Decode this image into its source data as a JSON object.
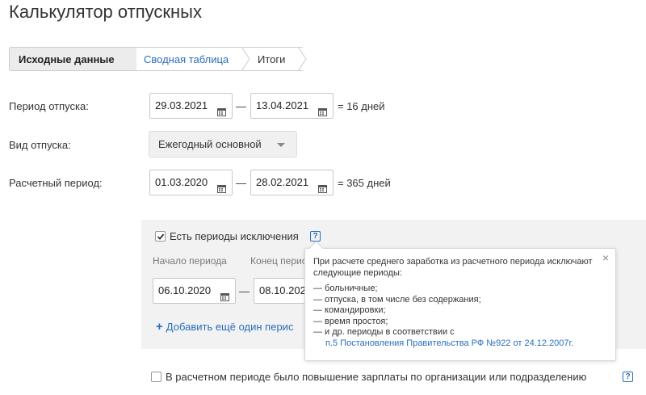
{
  "page": {
    "title": "Калькулятор отпускных"
  },
  "steps": [
    {
      "label": "Исходные данные"
    },
    {
      "label": "Сводная таблица"
    },
    {
      "label": "Итоги"
    }
  ],
  "vacation_period": {
    "label": "Период отпуска:",
    "from": "29.03.2021",
    "to": "13.04.2021",
    "separator": "—",
    "result": "= 16 дней"
  },
  "vacation_type": {
    "label": "Вид отпуска:",
    "selected": "Ежегодный основной"
  },
  "calc_period": {
    "label": "Расчетный период:",
    "from": "01.03.2020",
    "to": "28.02.2021",
    "separator": "—",
    "result": "= 365 дней"
  },
  "exclusions": {
    "checkbox_label": "Есть периоды исключения",
    "checked": true,
    "help": "?",
    "start_label": "Начало периода",
    "end_label": "Конец перио",
    "start_value": "06.10.2020",
    "end_value": "08.10.202",
    "separator": "—",
    "add_link": "Добавить ещё один перис"
  },
  "tooltip": {
    "close": "×",
    "intro": "При расчете среднего заработка из расчетного периода исключают следующие периоды:",
    "items": [
      "— больничные;",
      "— отпуска, в том числе без содержания;",
      "— командировки;",
      "— время простоя;",
      "— и др. периоды в соответствии с"
    ],
    "link": "п.5 Постановления Правительства РФ №922 от 24.12.2007г."
  },
  "salary_increase": {
    "label": "В расчетном периоде было повышение зарплаты по организации или подразделению",
    "checked": false,
    "help": "?"
  },
  "colors": {
    "link": "#2a6ebb",
    "panel": "#f2f2f2",
    "active_step": "#ececec"
  }
}
